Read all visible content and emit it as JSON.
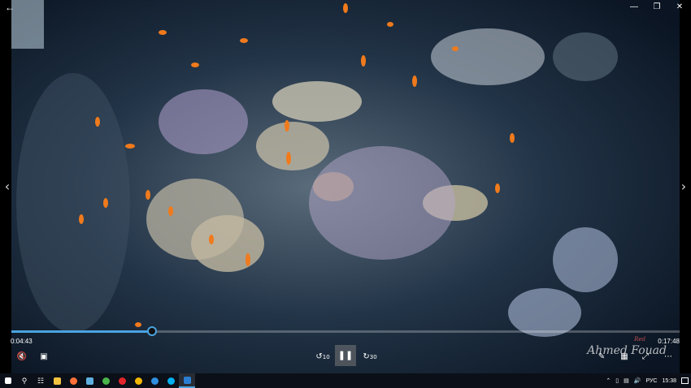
{
  "player": {
    "current_time": "0:04:43",
    "total_time": "0:17:48",
    "progress": 0.21,
    "watermark_text": "Ahmed Fouad",
    "watermark_small": "Red"
  },
  "icons": {
    "back": "back-arrow-icon",
    "minimize": "minimize-icon",
    "maximize": "maximize-icon",
    "close": "close-icon"
  },
  "controls": {
    "skip_back": "10",
    "skip_forward": "30"
  },
  "taskbar": {
    "language": "РУС",
    "clock": "15:38",
    "apps": [
      "windows-start",
      "search",
      "task-view",
      "file-explorer",
      "firefox",
      "vpn",
      "chrome-like",
      "opera",
      "chrome",
      "edge",
      "skype",
      "video-player"
    ]
  },
  "colors": {
    "accent": "#4aa3df",
    "taskbar_bg": "#0b0f18"
  }
}
